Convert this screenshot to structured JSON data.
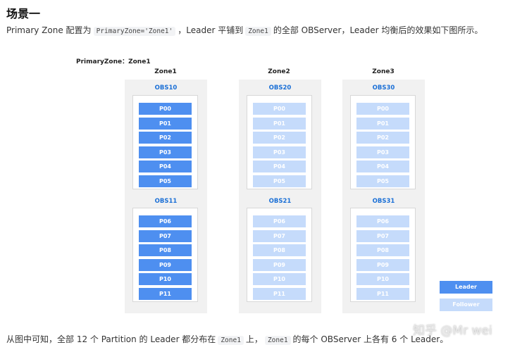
{
  "heading": "场景一",
  "intro": {
    "t1": "Primary Zone 配置为",
    "code1": "PrimaryZone='Zone1'",
    "t2": "，Leader 平铺到",
    "code2": "Zone1",
    "t3": "的全部 OBServer，Leader 均衡后的效果如下图所示。"
  },
  "diagram": {
    "primary_zone_label": "PrimaryZone：Zone1",
    "zones": [
      {
        "name": "Zone1",
        "servers": [
          {
            "name": "OBS10",
            "role": "leader",
            "partitions": [
              "P00",
              "P01",
              "P02",
              "P03",
              "P04",
              "P05"
            ]
          },
          {
            "name": "OBS11",
            "role": "leader",
            "partitions": [
              "P06",
              "P07",
              "P08",
              "P09",
              "P10",
              "P11"
            ]
          }
        ]
      },
      {
        "name": "Zone2",
        "servers": [
          {
            "name": "OBS20",
            "role": "follower",
            "partitions": [
              "P00",
              "P01",
              "P02",
              "P03",
              "P04",
              "P05"
            ]
          },
          {
            "name": "OBS21",
            "role": "follower",
            "partitions": [
              "P06",
              "P07",
              "P08",
              "P09",
              "P10",
              "P11"
            ]
          }
        ]
      },
      {
        "name": "Zone3",
        "servers": [
          {
            "name": "OBS30",
            "role": "follower",
            "partitions": [
              "P00",
              "P01",
              "P02",
              "P03",
              "P04",
              "P05"
            ]
          },
          {
            "name": "OBS31",
            "role": "follower",
            "partitions": [
              "P06",
              "P07",
              "P08",
              "P09",
              "P10",
              "P11"
            ]
          }
        ]
      }
    ],
    "legend": [
      {
        "label": "Leader",
        "color": "#4e8ff0"
      },
      {
        "label": "Follower",
        "color": "#c5dbfb"
      }
    ]
  },
  "conclusion": {
    "t1": "从图中可知，全部 12 个 Partition 的 Leader 都分布在",
    "code1": "Zone1",
    "t2": "上，",
    "code2": "Zone1",
    "t3": "的每个 OBServer 上各有 6 个 Leader。"
  },
  "watermark": "知乎 @Mr wei"
}
